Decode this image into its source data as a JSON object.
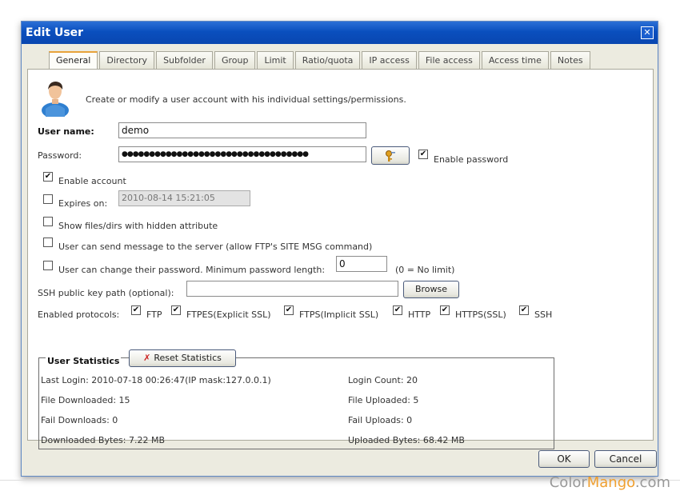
{
  "window": {
    "title": "Edit User",
    "close_glyph": "✕"
  },
  "tabs": [
    "General",
    "Directory",
    "Subfolder",
    "Group",
    "Limit",
    "Ratio/quota",
    "IP access",
    "File access",
    "Access time",
    "Notes"
  ],
  "general": {
    "intro": "Create or modify a user account with his individual settings/permissions.",
    "username_label": "User name:",
    "username_value": "demo",
    "password_label": "Password:",
    "password_value": "●●●●●●●●●●●●●●●●●●●●●●●●●●●●●●●●●●",
    "enable_password": "Enable password",
    "enable_account": "Enable account",
    "expires_on": "Expires on:",
    "expires_value": "2010-08-14 15:21:05",
    "hidden_attr": "Show files/dirs with hidden attribute",
    "site_msg": "User can send message to the server (allow FTP's SITE MSG command)",
    "change_password": "User can change their password. Minimum password length:",
    "min_length_value": "0",
    "no_limit": "(0 = No limit)",
    "ssh_key_label": "SSH public key path (optional):",
    "ssh_key_value": "",
    "browse": "Browse",
    "protocols_label": "Enabled protocols:",
    "protocols": [
      "FTP",
      "FTPES(Explicit SSL)",
      "FTPS(Implicit SSL)",
      "HTTP",
      "HTTPS(SSL)",
      "SSH"
    ]
  },
  "stats": {
    "title": "User Statistics",
    "reset": "Reset Statistics",
    "last_login": "Last Login: 2010-07-18 00:26:47(IP mask:127.0.0.1)",
    "login_count": "Login Count: 20",
    "file_downloaded": "File Downloaded: 15",
    "file_uploaded": "File Uploaded: 5",
    "fail_downloads": "Fail Downloads: 0",
    "fail_uploads": "Fail Uploads: 0",
    "downloaded_bytes": "Downloaded Bytes: 7.22 MB",
    "uploaded_bytes": "Uploaded Bytes: 68.42 MB"
  },
  "buttons": {
    "ok": "OK",
    "cancel": "Cancel"
  },
  "watermark": {
    "part1": "Color",
    "part2": "Mango",
    "part3": ".com"
  },
  "checkboxes": {
    "checked": "✔"
  },
  "colors": {
    "title_bar": "#0a4fbe",
    "tab_active_accent": "#e8a33a",
    "watermark_gray": "#999999",
    "watermark_orange": "#f0a030"
  }
}
